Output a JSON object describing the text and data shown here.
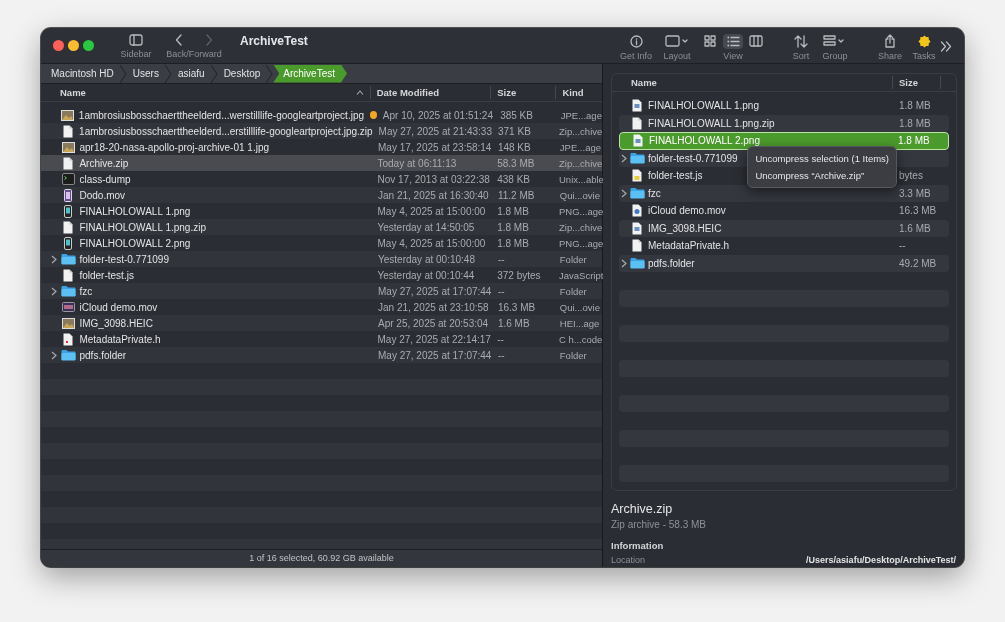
{
  "window": {
    "title": "ArchiveTest"
  },
  "toolbar": {
    "left_items": [
      {
        "kind": "sidebar",
        "label": "Sidebar"
      },
      {
        "kind": "back-forward",
        "label": "Back/Forward"
      }
    ],
    "right_items": [
      {
        "kind": "info",
        "label": "Get Info"
      },
      {
        "kind": "layout",
        "label": "Layout"
      },
      {
        "kind": "view",
        "label": "View"
      },
      {
        "kind": "sort",
        "label": "Sort"
      },
      {
        "kind": "group",
        "label": "Group"
      },
      {
        "kind": "share",
        "label": "Share"
      },
      {
        "kind": "tasks",
        "label": "Tasks"
      },
      {
        "kind": "more"
      }
    ],
    "view_modes": [
      {
        "kind": "icons",
        "selected": false
      },
      {
        "kind": "list",
        "selected": true
      },
      {
        "kind": "columns",
        "selected": false
      }
    ]
  },
  "breadcrumb": [
    {
      "label": "Macintosh HD",
      "selected": false
    },
    {
      "label": "Users",
      "selected": false
    },
    {
      "label": "asiafu",
      "selected": false
    },
    {
      "label": "Desktop",
      "selected": false
    },
    {
      "label": "ArchiveTest",
      "selected": true
    }
  ],
  "file_list": {
    "columns": [
      {
        "label": "Name",
        "sorted": true
      },
      {
        "label": "Date Modified",
        "sorted": false
      },
      {
        "label": "Size",
        "sorted": false
      },
      {
        "label": "Kind",
        "sorted": false
      }
    ],
    "rows": [
      {
        "name": "1ambrosiusbosschaerttheelderd...werstilllife-googleartproject.jpg",
        "date": "Apr 10, 2025 at 01:51:24",
        "size": "385 KB",
        "file_type": "JPE...age",
        "kind": "image",
        "expandable": false,
        "selected": false,
        "color": "#f5a623"
      },
      {
        "name": "1ambrosiusbosschaerttheelderd...erstilllife-googleartproject.jpg.zip",
        "date": "May 27, 2025 at 21:43:33",
        "size": "371 KB",
        "file_type": "Zip...chive",
        "kind": "document",
        "expandable": false,
        "selected": false
      },
      {
        "name": "apr18-20-nasa-apollo-proj-archive-01 1.jpg",
        "date": "May 17, 2025 at 23:58:14",
        "size": "148 KB",
        "file_type": "JPE...age",
        "kind": "image",
        "expandable": false,
        "selected": false
      },
      {
        "name": "Archive.zip",
        "date": "Today at 06:11:13",
        "size": "58.3 MB",
        "file_type": "Zip...chive",
        "kind": "document",
        "expandable": false,
        "selected": true
      },
      {
        "name": "class-dump",
        "date": "Nov 17, 2013 at 03:22:38",
        "size": "438 KB",
        "file_type": "Unix...able",
        "kind": "terminal",
        "expandable": false,
        "selected": false
      },
      {
        "name": "Dodo.mov",
        "date": "Jan 21, 2025 at 16:30:40",
        "size": "11.2 MB",
        "file_type": "Qui...ovie",
        "kind": "movie",
        "expandable": false,
        "selected": false
      },
      {
        "name": "FINALHOLOWALL 1.png",
        "date": "May 4, 2025 at 15:00:00",
        "size": "1.8 MB",
        "file_type": "PNG...age",
        "kind": "phone",
        "expandable": false,
        "selected": false
      },
      {
        "name": "FINALHOLOWALL 1.png.zip",
        "date": "Yesterday at 14:50:05",
        "size": "1.8 MB",
        "file_type": "Zip...chive",
        "kind": "document",
        "expandable": false,
        "selected": false
      },
      {
        "name": "FINALHOLOWALL 2.png",
        "date": "May 4, 2025 at 15:00:00",
        "size": "1.8 MB",
        "file_type": "PNG...age",
        "kind": "phone",
        "expandable": false,
        "selected": false
      },
      {
        "name": "folder-test-0.771099",
        "date": "Yesterday at 00:10:48",
        "size": "--",
        "file_type": "Folder",
        "kind": "folder",
        "expandable": true,
        "selected": false
      },
      {
        "name": "folder-test.js",
        "date": "Yesterday at 00:10:44",
        "size": "372 bytes",
        "file_type": "JavaScript",
        "kind": "document",
        "expandable": false,
        "selected": false
      },
      {
        "name": "fzc",
        "date": "May 27, 2025 at 17:07:44",
        "size": "--",
        "file_type": "Folder",
        "kind": "folder",
        "expandable": true,
        "selected": false
      },
      {
        "name": "iCloud demo.mov",
        "date": "Jan 21, 2025 at 23:10:58",
        "size": "16.3 MB",
        "file_type": "Qui...ovie",
        "kind": "movie-wide",
        "expandable": false,
        "selected": false
      },
      {
        "name": "IMG_3098.HEIC",
        "date": "Apr 25, 2025 at 20:53:04",
        "size": "1.6 MB",
        "file_type": "HEI...age",
        "kind": "image",
        "expandable": false,
        "selected": false
      },
      {
        "name": "MetadataPrivate.h",
        "date": "May 27, 2025 at 22:14:17",
        "size": "--",
        "file_type": "C h...code",
        "kind": "header",
        "expandable": false,
        "selected": false
      },
      {
        "name": "pdfs.folder",
        "date": "May 27, 2025 at 17:07:44",
        "size": "--",
        "file_type": "Folder",
        "kind": "folder",
        "expandable": true,
        "selected": false
      }
    ]
  },
  "status_bar": "1 of 16 selected, 60.92 GB available",
  "archive_pane": {
    "columns": [
      {
        "label": "Name"
      },
      {
        "label": "Size"
      }
    ],
    "rows": [
      {
        "name": "FINALHOLOWALL 1.png",
        "size": "1.8 MB",
        "kind": "image-doc",
        "expandable": false,
        "selected": false
      },
      {
        "name": "FINALHOLOWALL 1.png.zip",
        "size": "1.8 MB",
        "kind": "document",
        "expandable": false,
        "selected": false
      },
      {
        "name": "FINALHOLOWALL 2.png",
        "size": "1.8 MB",
        "kind": "image-doc",
        "expandable": false,
        "selected": true
      },
      {
        "name": "folder-test-0.771099",
        "kind": "folder",
        "expandable": true,
        "selected": false
      },
      {
        "name": "folder-test.js",
        "size": "bytes",
        "kind": "script-doc",
        "expandable": false,
        "selected": false
      },
      {
        "name": "fzc",
        "size": "3.3 MB",
        "kind": "folder",
        "expandable": true,
        "selected": false
      },
      {
        "name": "iCloud demo.mov",
        "size": "16.3 MB",
        "kind": "video-doc",
        "expandable": false,
        "selected": false
      },
      {
        "name": "IMG_3098.HEIC",
        "size": "1.6 MB",
        "kind": "image-doc",
        "expandable": false,
        "selected": false
      },
      {
        "name": "MetadataPrivate.h",
        "size": "--",
        "kind": "document",
        "expandable": false,
        "selected": false
      },
      {
        "name": "pdfs.folder",
        "size": "49.2 MB",
        "kind": "folder",
        "expandable": true,
        "selected": false
      }
    ],
    "preview": {
      "name": "Archive.zip",
      "subtitle": "Zip archive - 58.3 MB",
      "section": "Information",
      "fields": [
        {
          "label": "Location",
          "value": "/Users/asiafu/Desktop/ArchiveTest/"
        }
      ]
    }
  },
  "context_menu": {
    "items": [
      "Uncompress selection (1 Items)",
      "Uncompress “Archive.zip”"
    ]
  }
}
